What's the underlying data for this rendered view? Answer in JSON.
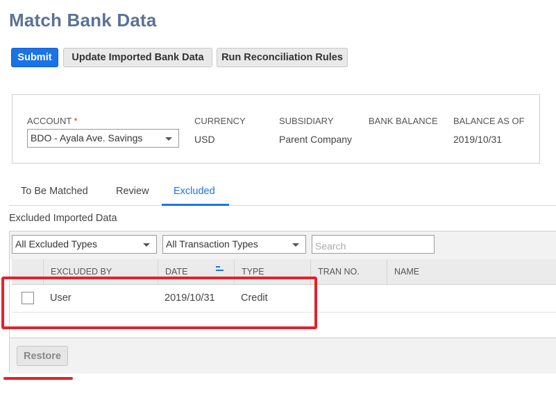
{
  "page": {
    "title": "Match Bank Data"
  },
  "toolbar": {
    "submit_label": "Submit",
    "update_label": "Update Imported Bank Data",
    "run_rules_label": "Run Reconciliation Rules"
  },
  "summary": {
    "account_label": "ACCOUNT",
    "account_required_mark": "*",
    "account_value": "BDO - Ayala Ave. Savings",
    "currency_label": "CURRENCY",
    "currency_value": "USD",
    "subsidiary_label": "SUBSIDIARY",
    "subsidiary_value": "Parent Company",
    "bank_balance_label": "BANK BALANCE",
    "bank_balance_value": "",
    "balance_as_of_label": "BALANCE AS OF",
    "balance_as_of_value": "2019/10/31"
  },
  "tabs": [
    {
      "label": "To Be Matched",
      "active": false
    },
    {
      "label": "Review",
      "active": false
    },
    {
      "label": "Excluded",
      "active": true
    }
  ],
  "section": {
    "title": "Excluded Imported Data"
  },
  "filters": {
    "excluded_types": "All Excluded Types",
    "transaction_types": "All Transaction Types",
    "search_placeholder": "Search"
  },
  "table": {
    "columns": [
      "EXCLUDED BY",
      "DATE",
      "TYPE",
      "TRAN NO.",
      "NAME"
    ],
    "sorted_column": "DATE",
    "rows": [
      {
        "excluded_by": "User",
        "date": "2019/10/31",
        "type": "Credit",
        "tran_no": "",
        "name": ""
      }
    ]
  },
  "footer": {
    "restore_label": "Restore"
  },
  "colors": {
    "accent": "#1a73e8",
    "title": "#5a7295",
    "annotation": "#e3222c"
  }
}
